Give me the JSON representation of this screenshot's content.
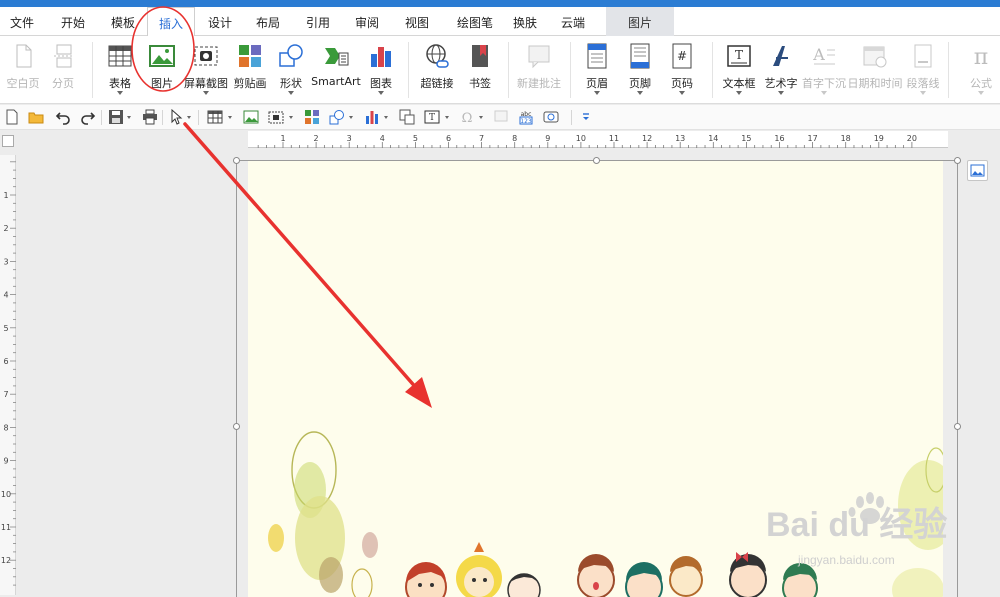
{
  "tabs": [
    {
      "label": "文件"
    },
    {
      "label": "开始"
    },
    {
      "label": "模板"
    },
    {
      "label": "插入"
    },
    {
      "label": "设计"
    },
    {
      "label": "布局"
    },
    {
      "label": "引用"
    },
    {
      "label": "审阅"
    },
    {
      "label": "视图"
    },
    {
      "label": "绘图笔"
    },
    {
      "label": "换肤"
    },
    {
      "label": "云端"
    },
    {
      "label": "图片"
    }
  ],
  "active_tab": "插入",
  "ribbon": {
    "blank_page": "空白页",
    "page_break": "分页",
    "table": "表格",
    "picture": "图片",
    "screenshot": "屏幕截图",
    "clipart": "剪贴画",
    "shapes": "形状",
    "smartart": "SmartArt",
    "chart": "图表",
    "hyperlink": "超链接",
    "bookmark": "书签",
    "new_comment": "新建批注",
    "header": "页眉",
    "footer": "页脚",
    "page_number": "页码",
    "text_box": "文本框",
    "wordart": "艺术字",
    "drop_cap": "首字下沉",
    "date_time": "日期和时间",
    "horizontal_line": "段落线",
    "equation": "公式"
  },
  "ruler": {
    "horizontal_ticks": [
      "1",
      "2",
      "3",
      "4",
      "5",
      "6",
      "7",
      "8",
      "9",
      "10",
      "11",
      "12",
      "13",
      "14",
      "15",
      "16",
      "17",
      "18",
      "19",
      "20"
    ],
    "vertical_ticks": [
      "1",
      "2",
      "3",
      "4",
      "5",
      "6",
      "7",
      "8",
      "9",
      "10",
      "11",
      "12"
    ]
  },
  "watermark": {
    "logo_text": "Bai du 经验",
    "url_text": "jingyan.baidu.com"
  },
  "colors": {
    "accent": "#2b7cd3",
    "active_tab_text": "#2b6fd6",
    "annotation_red": "#e8322f",
    "page_background": "#fefdec"
  },
  "icons": {
    "document-new": "blank-page-icon",
    "picture": "picture-icon",
    "annotation": "red-circle-and-arrow"
  }
}
